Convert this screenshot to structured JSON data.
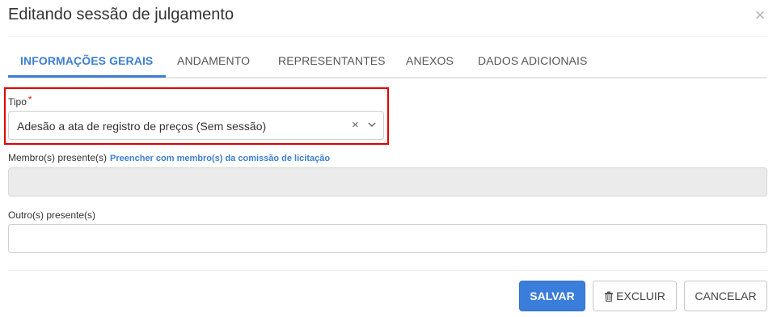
{
  "dialog": {
    "title": "Editando sessão de julgamento",
    "close_symbol": "×"
  },
  "tabs": [
    {
      "label": "INFORMAÇÕES GERAIS",
      "active": true
    },
    {
      "label": "ANDAMENTO",
      "active": false
    },
    {
      "label": "REPRESENTANTES",
      "active": false
    },
    {
      "label": "ANEXOS",
      "active": false
    },
    {
      "label": "DADOS ADICIONAIS",
      "active": false
    }
  ],
  "form": {
    "tipo": {
      "label": "Tipo",
      "required_mark": "*",
      "value": "Adesão a ata de registro de preços (Sem sessão)",
      "clear_symbol": "×"
    },
    "membros": {
      "label": "Membro(s) presente(s)",
      "link": "Preencher com membro(s) da comissão de licitação",
      "value": ""
    },
    "outros": {
      "label": "Outro(s) presente(s)",
      "value": ""
    }
  },
  "buttons": {
    "save": "SALVAR",
    "delete": "EXCLUIR",
    "cancel": "CANCELAR"
  },
  "colors": {
    "primary": "#3b7ddb",
    "tab_active": "#3d7fd0",
    "highlight": "#e00000",
    "required": "#e01818"
  },
  "icons": {
    "close": "close-icon",
    "clear": "clear-icon",
    "dropdown": "chevron-down-icon",
    "delete": "trash-icon"
  }
}
